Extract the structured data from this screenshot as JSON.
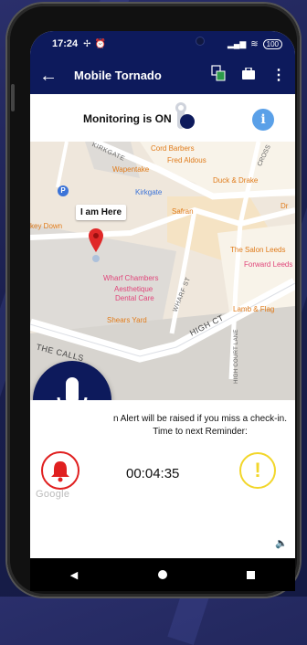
{
  "status": {
    "time": "17:24",
    "battery": "100"
  },
  "appbar": {
    "title": "Mobile Tornado"
  },
  "monitoring": {
    "label": "Monitoring is ON",
    "info_glyph": "i"
  },
  "map": {
    "marker_label": "I am Here",
    "places": [
      "Cord Barbers",
      "Fred Aldous",
      "Wapentake",
      "Duck & Drake",
      "Kirkgate",
      "Safran",
      "The Salon Leeds",
      "Forward Leeds",
      "Wharf Chambers",
      "Aesthetique",
      "Dental Care",
      "Shears Yard",
      "Lamb & Flag",
      "Dr",
      "key Down"
    ],
    "streets": [
      "KIRKGATE",
      "CROSS",
      "WHARF ST",
      "HIGH CT",
      "HIGH COURT LANE",
      "THE CALLS"
    ]
  },
  "alert": {
    "line1": "n Alert will be raised if you miss a check-in.",
    "line2": "Time to next Reminder:",
    "countdown": "00:04:35",
    "warn_glyph": "!",
    "google": "Google"
  },
  "colors": {
    "navy": "#0d1a5c",
    "accent_blue": "#5aa0e8",
    "alarm_red": "#e02020",
    "warn_yellow": "#f2d62a",
    "map_orange": "#f39c38",
    "map_pink": "#e0457a"
  }
}
